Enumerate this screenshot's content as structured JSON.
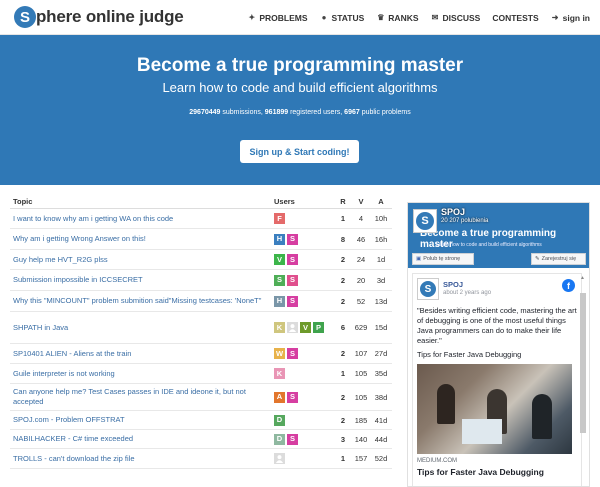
{
  "brand": {
    "logo_letter": "S",
    "name": "phere online judge"
  },
  "nav": [
    {
      "icon": "puzzle-icon",
      "glyph": "✦",
      "label": "PROBLEMS"
    },
    {
      "icon": "status-icon",
      "glyph": "●",
      "label": "STATUS"
    },
    {
      "icon": "trophy-icon",
      "glyph": "♛",
      "label": "RANKS"
    },
    {
      "icon": "chat-icon",
      "glyph": "✉",
      "label": "DISCUSS"
    },
    {
      "icon": "",
      "glyph": "",
      "label": "CONTESTS"
    },
    {
      "icon": "sign-in-icon",
      "glyph": "➜",
      "label": "sign in"
    }
  ],
  "hero": {
    "title": "Become a true programming master",
    "subtitle": "Learn how to code and build efficient algorithms",
    "submissions": "29670449",
    "submissions_label": " submissions, ",
    "users": "961899",
    "users_label": " registered users, ",
    "problems": "6967",
    "problems_label": " public problems",
    "cta": "Sign up & Start coding!"
  },
  "table": {
    "headers": {
      "topic": "Topic",
      "users": "Users",
      "r": "R",
      "v": "V",
      "a": "A"
    },
    "rows": [
      {
        "topic": "I want to know why am i getting WA on this code",
        "users": [
          {
            "l": "F",
            "c": "#e46a6a"
          }
        ],
        "r": "1",
        "v": "4",
        "a": "10h"
      },
      {
        "topic": "Why am i getting Wrong Answer on this!",
        "users": [
          {
            "l": "H",
            "c": "#3b7fbf"
          },
          {
            "l": "S",
            "c": "#d63ea1"
          }
        ],
        "r": "8",
        "v": "46",
        "a": "16h"
      },
      {
        "topic": "Guy help me HVT_R2G plss",
        "users": [
          {
            "l": "V",
            "c": "#3cb54a"
          },
          {
            "l": "S",
            "c": "#d63ea1"
          }
        ],
        "r": "2",
        "v": "24",
        "a": "1d"
      },
      {
        "topic": "Submission impossible in ICCSECRET",
        "users": [
          {
            "l": "S",
            "c": "#4fae57"
          },
          {
            "l": "S",
            "c": "#e04f8d"
          }
        ],
        "r": "2",
        "v": "20",
        "a": "3d"
      },
      {
        "topic": "Why this \"MINCOUNT\" problem submition said\"Missing testcases: 'NoneT\"",
        "users": [
          {
            "l": "H",
            "c": "#7a96a8"
          },
          {
            "l": "S",
            "c": "#d63ea1"
          }
        ],
        "r": "2",
        "v": "52",
        "a": "13d"
      },
      {
        "topic": "SHPATH in Java",
        "users": [
          {
            "l": "K",
            "c": "#cfc67e"
          },
          {
            "l": "",
            "c": "ph"
          },
          {
            "l": "V",
            "c": "#6d9a2a"
          },
          {
            "l": "P",
            "c": "#3fa34d"
          }
        ],
        "r": "6",
        "v": "629",
        "a": "15d"
      },
      {
        "topic": "SP10401 ALIEN - Aliens at the train",
        "users": [
          {
            "l": "W",
            "c": "#e8b24a"
          },
          {
            "l": "S",
            "c": "#d63ea1"
          }
        ],
        "r": "2",
        "v": "107",
        "a": "27d"
      },
      {
        "topic": "Guile interpreter is not working",
        "users": [
          {
            "l": "K",
            "c": "#e995b5"
          }
        ],
        "r": "1",
        "v": "105",
        "a": "35d"
      },
      {
        "topic": "Can anyone help me? Test Cases passes in IDE and ideone it, but not accepted",
        "users": [
          {
            "l": "A",
            "c": "#e2762c"
          },
          {
            "l": "S",
            "c": "#d63ea1"
          }
        ],
        "r": "2",
        "v": "105",
        "a": "38d"
      },
      {
        "topic": "SPOJ.com - Problem OFFSTRAT",
        "users": [
          {
            "l": "D",
            "c": "#56a85e"
          }
        ],
        "r": "2",
        "v": "185",
        "a": "41d"
      },
      {
        "topic": "NABILHACKER - C# time exceeded",
        "users": [
          {
            "l": "D",
            "c": "#8fb8a0"
          },
          {
            "l": "S",
            "c": "#d63ea1"
          }
        ],
        "r": "3",
        "v": "140",
        "a": "44d"
      },
      {
        "topic": "TROLLS - can't download the zip file",
        "users": [
          {
            "l": "",
            "c": "ph"
          }
        ],
        "r": "1",
        "v": "157",
        "a": "52d"
      }
    ]
  },
  "facebook": {
    "page_name": "SPOJ",
    "cover_title": "Become a true programming master",
    "cover_sub": "Learn how to code and build efficient algorithms",
    "likes": "20 207 polubienia",
    "like_btn": "Polub tę stronę",
    "register_btn": "Zarejestruj się",
    "post": {
      "author": "SPOJ",
      "time": "about 2 years ago",
      "text": "\"Besides writing efficient code, mastering the art of debugging is one of the most useful things Java programmers can do to make their life easier.\"",
      "tip": "Tips for Faster Java Debugging",
      "domain": "MEDIUM.COM",
      "title": "Tips for Faster Java Debugging"
    }
  }
}
